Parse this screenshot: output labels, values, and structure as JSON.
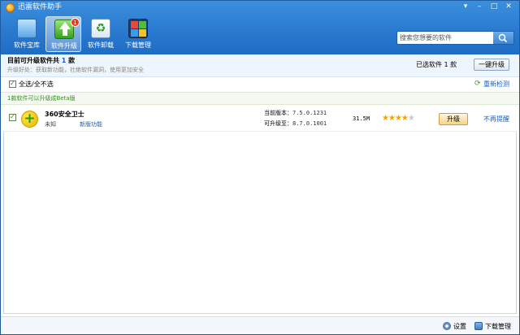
{
  "window": {
    "title": "迅雷软件助手"
  },
  "toolbar": {
    "items": [
      {
        "label": "软件宝库",
        "icon": "software-library-icon"
      },
      {
        "label": "软件升级",
        "icon": "software-upgrade-icon",
        "badge": "1",
        "active": true
      },
      {
        "label": "软件卸载",
        "icon": "software-uninstall-icon"
      },
      {
        "label": "下载管理",
        "icon": "download-manager-icon"
      }
    ]
  },
  "search": {
    "placeholder": "搜索您想要的软件"
  },
  "info": {
    "title_prefix": "目前可升级软件共 ",
    "title_count": "1",
    "title_suffix": " 款",
    "subtitle": "升级好处：获取新功能，社绝软件漏洞，使用更加安全",
    "selected": "已选软件 1 款",
    "update_all": "一键升级"
  },
  "select_all": {
    "label": "全选/全不选",
    "checked": true,
    "recheck": "重新检测"
  },
  "beta_notice": "1款软件可以升级成Beta版",
  "items": [
    {
      "name": "360安全卫士",
      "status": "未知",
      "new_features": "新版功能",
      "current_label": "当前版本：",
      "current_version": "7.5.0.1231",
      "upgradable_label": "可升级至：",
      "upgradable_version": "8.7.0.1001",
      "size": "31.5M",
      "rating": 4,
      "rating_max": 5,
      "upgrade_label": "升级",
      "no_remind": "不再提醒",
      "checked": true
    }
  ],
  "status_bar": {
    "settings": "设置",
    "download_manager": "下载管理"
  },
  "colors": {
    "header": "#2a7ad0",
    "link": "#1a5fbf",
    "beta": "#3a8f20"
  }
}
